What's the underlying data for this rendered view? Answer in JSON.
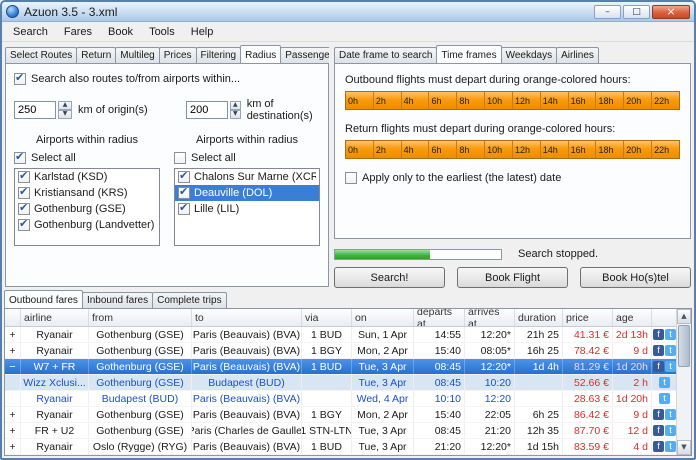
{
  "window": {
    "title": "Azuon 3.5 - 3.xml"
  },
  "menu": {
    "items": [
      "Search",
      "Fares",
      "Book",
      "Tools",
      "Help"
    ]
  },
  "left_tabs": {
    "tabs": [
      "Select Routes",
      "Return",
      "Multileg",
      "Prices",
      "Filtering",
      "Radius",
      "Passengers"
    ],
    "active_index": 5
  },
  "radius": {
    "search_within_label": "Search also routes to/from airports within...",
    "search_within_checked": true,
    "origin": {
      "value": "250",
      "label": "km of origin(s)"
    },
    "destination": {
      "value": "200",
      "label": "km of destination(s)"
    },
    "origin_list": {
      "title": "Airports within radius",
      "select_all_label": "Select all",
      "select_all_checked": true,
      "items": [
        {
          "label": "Karlstad (KSD)",
          "checked": true,
          "selected": false
        },
        {
          "label": "Kristiansand (KRS)",
          "checked": true,
          "selected": false
        },
        {
          "label": "Gothenburg (GSE)",
          "checked": true,
          "selected": false
        },
        {
          "label": "Gothenburg (Landvetter) (GO",
          "checked": true,
          "selected": false
        }
      ]
    },
    "destination_list": {
      "title": "Airports within radius",
      "select_all_label": "Select all",
      "select_all_checked": false,
      "items": [
        {
          "label": "Chalons Sur Marne (XCR)",
          "checked": true,
          "selected": false
        },
        {
          "label": "Deauville (DOL)",
          "checked": true,
          "selected": true
        },
        {
          "label": "Lille (LIL)",
          "checked": true,
          "selected": false
        }
      ]
    }
  },
  "right_tabs": {
    "tabs": [
      "Date frame to search",
      "Time frames",
      "Weekdays",
      "Airlines"
    ],
    "active_index": 1
  },
  "time_frames": {
    "outbound_label": "Outbound flights must depart during orange-colored hours:",
    "return_label": "Return flights must depart during orange-colored hours:",
    "hours": [
      "0h",
      "2h",
      "4h",
      "6h",
      "8h",
      "10h",
      "12h",
      "14h",
      "16h",
      "18h",
      "20h",
      "22h"
    ],
    "apply_label": "Apply only to the earliest (the latest) date",
    "apply_checked": false
  },
  "status": {
    "progress_percent": 57,
    "text": "Search stopped."
  },
  "actions": {
    "search": "Search!",
    "book_flight": "Book Flight",
    "book_hostel": "Book Ho(s)tel"
  },
  "colors": {
    "hour_block_orange": "#F79A1F",
    "price_red": "#E02A2A",
    "selection_blue": "#2A6FD0",
    "leg_text_blue": "#1B50C8",
    "progress_green": "#3CB43C"
  },
  "results": {
    "tabs": [
      "Outbound fares",
      "Inbound fares",
      "Complete trips"
    ],
    "active_index": 0,
    "columns": [
      "",
      "airline",
      "from",
      "to",
      "via",
      "on",
      "departs at",
      "arrives at",
      "duration",
      "price",
      "age",
      ""
    ],
    "rows": [
      {
        "expand": "+",
        "airline": "Ryanair",
        "from": "Gothenburg (GSE)",
        "to": "Paris (Beauvais) (BVA)",
        "via": "1 BUD",
        "on": "Sun, 1 Apr",
        "departs": "14:55",
        "arrives": "12:20*",
        "duration": "21h 25",
        "price": "41.31 €",
        "age": "2d 13h",
        "type": "parent",
        "selected": false,
        "highlight": false,
        "icons": [
          "facebook",
          "twitter"
        ]
      },
      {
        "expand": "+",
        "airline": "Ryanair",
        "from": "Gothenburg (GSE)",
        "to": "Paris (Beauvais) (BVA)",
        "via": "1 BGY",
        "on": "Mon, 2 Apr",
        "departs": "15:40",
        "arrives": "08:05*",
        "duration": "16h 25",
        "price": "78.42 €",
        "age": "9 d",
        "type": "parent",
        "selected": false,
        "highlight": false,
        "icons": [
          "facebook",
          "twitter"
        ]
      },
      {
        "expand": "−",
        "airline": "W7 + FR",
        "from": "Gothenburg (GSE)",
        "to": "Paris (Beauvais) (BVA)",
        "via": "1 BUD",
        "on": "Tue, 3 Apr",
        "departs": "08:45",
        "arrives": "12:20*",
        "duration": "1d 4h",
        "price": "81.29 €",
        "age": "1d 20h",
        "type": "parent",
        "selected": true,
        "highlight": false,
        "icons": [
          "facebook",
          "twitter"
        ]
      },
      {
        "expand": "",
        "airline": "Wizz Xclusi...",
        "from": "Gothenburg (GSE)",
        "to": "Budapest (BUD)",
        "via": "",
        "on": "Tue, 3 Apr",
        "departs": "08:45",
        "arrives": "10:20",
        "duration": "",
        "price": "52.66 €",
        "age": "2 h",
        "type": "leg",
        "selected": false,
        "highlight": true,
        "icons": [
          "twitter"
        ]
      },
      {
        "expand": "",
        "airline": "Ryanair",
        "from": "Budapest (BUD)",
        "to": "Paris (Beauvais) (BVA)",
        "via": "",
        "on": "Wed, 4 Apr",
        "departs": "10:10",
        "arrives": "12:20",
        "duration": "",
        "price": "28.63 €",
        "age": "1d 20h",
        "type": "leg",
        "selected": false,
        "highlight": false,
        "icons": [
          "twitter"
        ]
      },
      {
        "expand": "+",
        "airline": "Ryanair",
        "from": "Gothenburg (GSE)",
        "to": "Paris (Beauvais) (BVA)",
        "via": "1 BGY",
        "on": "Mon, 2 Apr",
        "departs": "15:40",
        "arrives": "22:05",
        "duration": "6h 25",
        "price": "86.42 €",
        "age": "9 d",
        "type": "parent",
        "selected": false,
        "highlight": false,
        "icons": [
          "facebook",
          "twitter"
        ]
      },
      {
        "expand": "+",
        "airline": "FR + U2",
        "from": "Gothenburg (GSE)",
        "to": "Paris (Charles de Gaulle)",
        "via": "1 STN-LTN",
        "on": "Tue, 3 Apr",
        "departs": "08:45",
        "arrives": "21:20",
        "duration": "12h 35",
        "price": "87.70 €",
        "age": "12 d",
        "type": "parent",
        "selected": false,
        "highlight": false,
        "icons": [
          "facebook",
          "twitter"
        ]
      },
      {
        "expand": "+",
        "airline": "Ryanair",
        "from": "Oslo (Rygge) (RYG)",
        "to": "Paris (Beauvais) (BVA)",
        "via": "1 BUD",
        "on": "Tue, 3 Apr",
        "departs": "21:20",
        "arrives": "12:20*",
        "duration": "1d 15h",
        "price": "83.59 €",
        "age": "4 d",
        "type": "parent",
        "selected": false,
        "highlight": false,
        "icons": [
          "facebook",
          "twitter"
        ]
      }
    ]
  }
}
